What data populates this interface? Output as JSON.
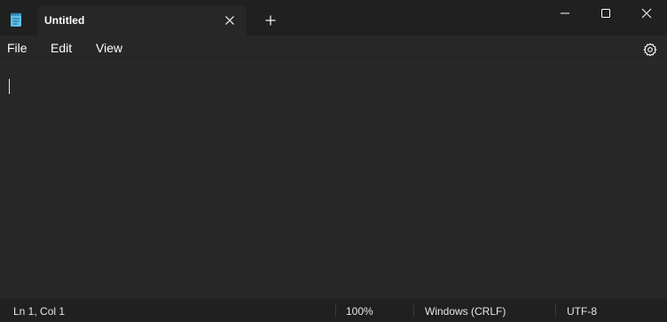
{
  "tab": {
    "title": "Untitled"
  },
  "menu": {
    "file": "File",
    "edit": "Edit",
    "view": "View"
  },
  "status": {
    "position": "Ln 1, Col 1",
    "zoom": "100%",
    "line_ending": "Windows (CRLF)",
    "encoding": "UTF-8"
  },
  "icons": {
    "app": "notepad-icon",
    "tab_close": "close-icon",
    "new_tab": "plus-icon",
    "minimize": "minimize-icon",
    "maximize": "maximize-icon",
    "close": "close-icon",
    "settings": "gear-icon"
  },
  "colors": {
    "titlebar": "#202020",
    "editor": "#272727",
    "accent_icon": "#5ec1e8"
  }
}
